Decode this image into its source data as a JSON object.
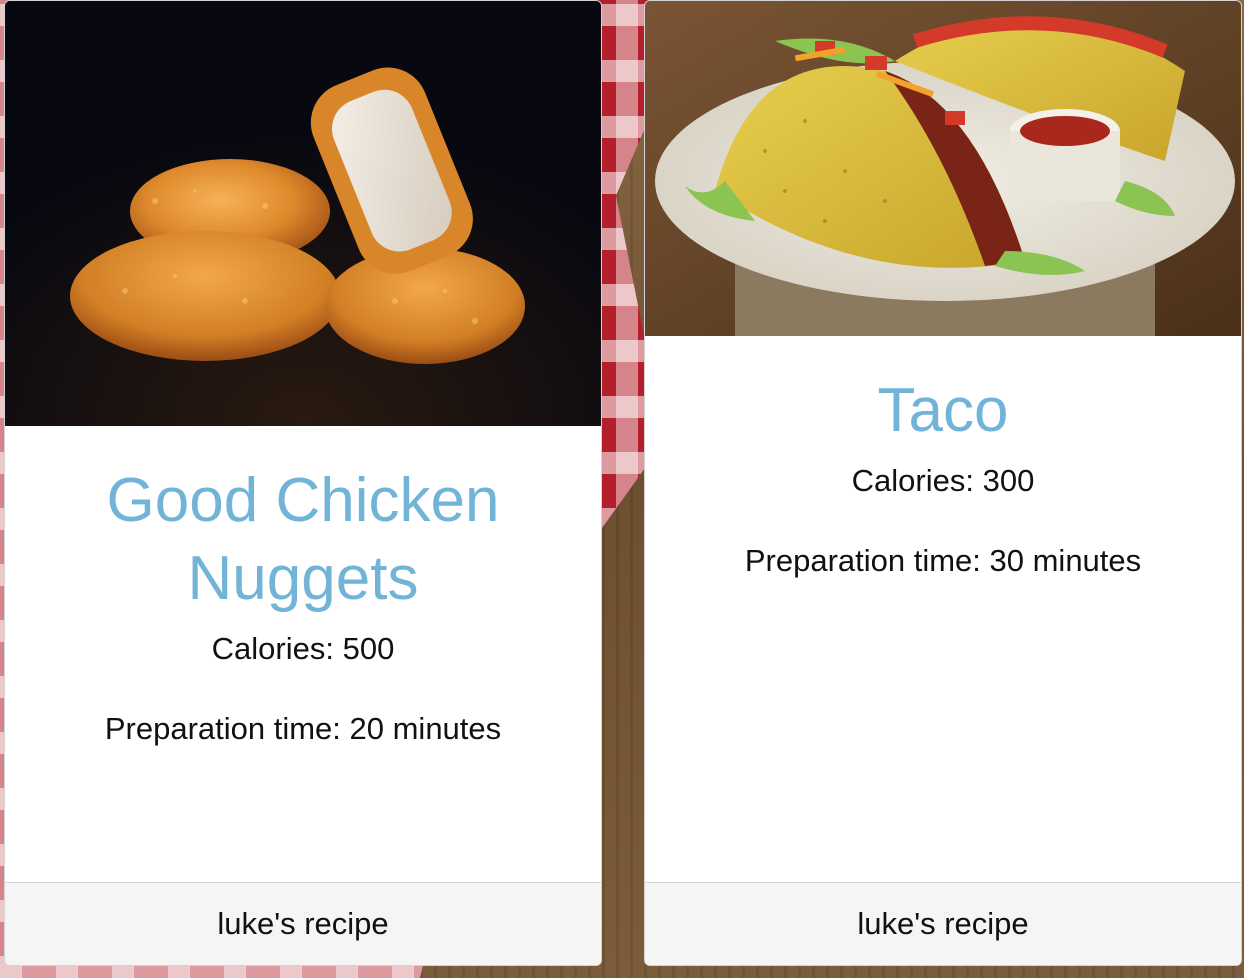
{
  "recipes": [
    {
      "title": "Good Chicken Nuggets",
      "calories": "Calories: 500",
      "prep_time": "Preparation time: 20 minutes",
      "footer": "luke's recipe",
      "image_icon": "chicken-nuggets-photo"
    },
    {
      "title": "Taco",
      "calories": "Calories: 300",
      "prep_time": "Preparation time: 30 minutes",
      "footer": "luke's recipe",
      "image_icon": "taco-photo"
    }
  ],
  "colors": {
    "title": "#72b3d8",
    "text": "#111111",
    "card_bg": "#ffffff",
    "footer_bg": "#f5f5f5"
  }
}
